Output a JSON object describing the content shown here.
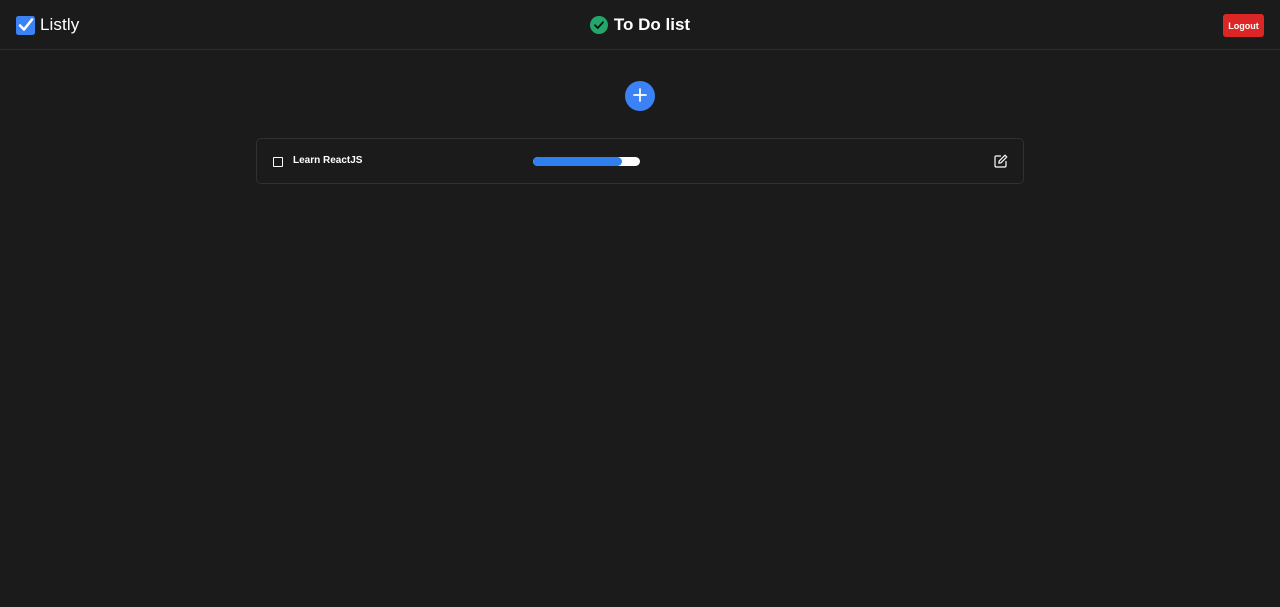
{
  "header": {
    "app_name": "Listly",
    "brand_icon": "checkbox-checked-icon",
    "title": "To Do list",
    "title_icon": "check-circle-icon",
    "logout_label": "Logout"
  },
  "actions": {
    "add_icon": "plus-icon"
  },
  "todos": [
    {
      "label": "Learn ReactJS",
      "checked": false,
      "progress": 0.83,
      "edit_icon": "edit-icon"
    }
  ],
  "colors": {
    "background": "#1b1b1c",
    "accent": "#3b82f6",
    "progress_fill": "#2f7ff0",
    "success": "#22a66b",
    "danger": "#dc2626"
  }
}
